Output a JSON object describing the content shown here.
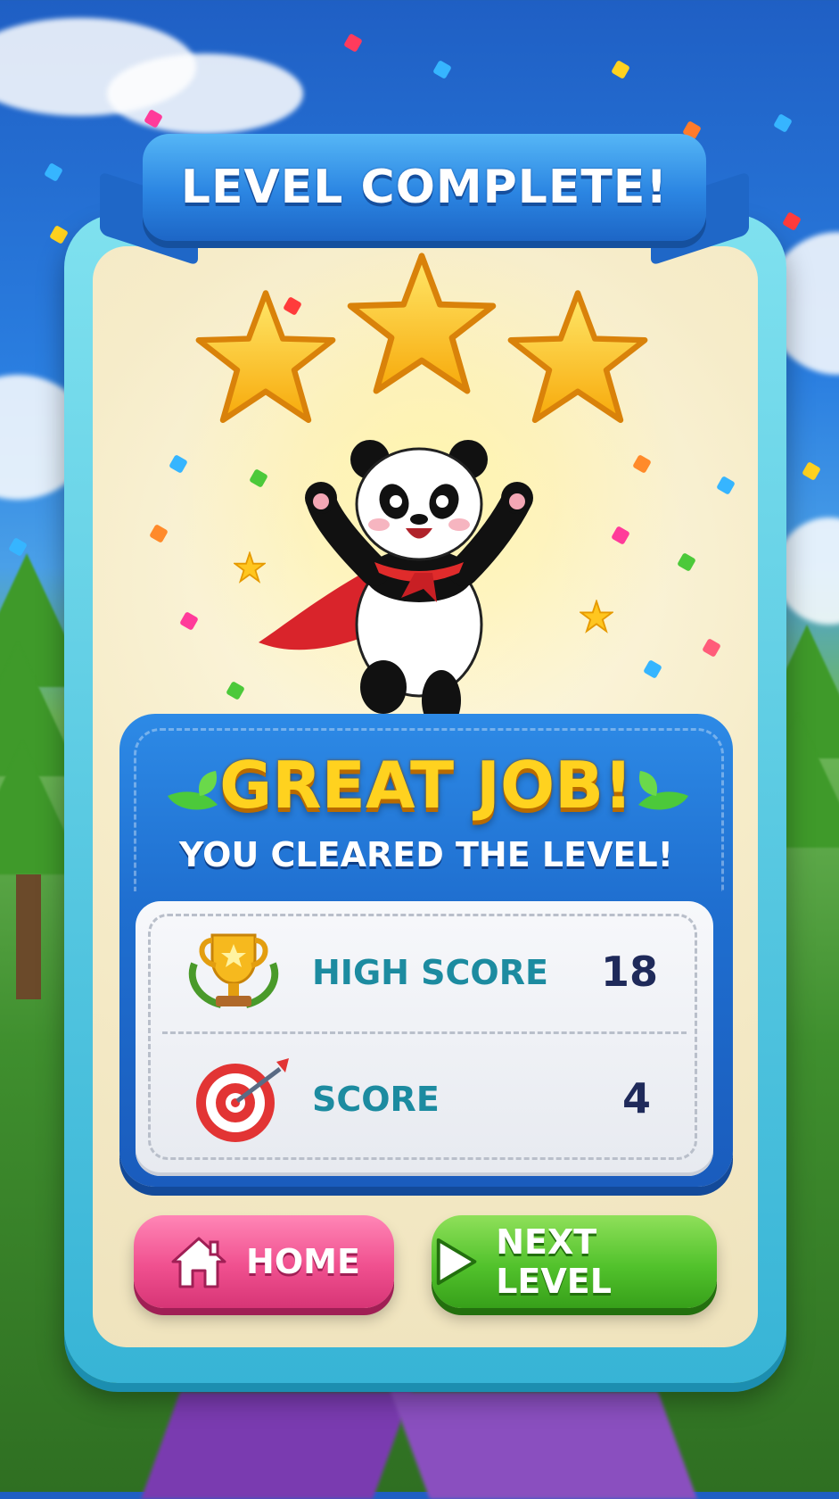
{
  "dialog": {
    "title": "LEVEL COMPLETE!",
    "stars_earned": 3,
    "stars_total": 3,
    "headline": "GREAT JOB!",
    "subheadline": "YOU CLEARED THE LEVEL!"
  },
  "stats": [
    {
      "label": "HIGH SCORE",
      "value": "18",
      "icon": "trophy-icon"
    },
    {
      "label": "SCORE",
      "value": "4",
      "icon": "target-icon"
    }
  ],
  "buttons": {
    "home_label": "HOME",
    "next_label": "NEXT LEVEL"
  },
  "colors": {
    "ribbon": "#2b85e2",
    "panel": "#1f6fd0",
    "star": "#ffc61f",
    "home_button": "#f0508f",
    "next_button": "#52c22c",
    "stat_label": "#1c8ba0",
    "stat_value": "#1f2a5a"
  }
}
